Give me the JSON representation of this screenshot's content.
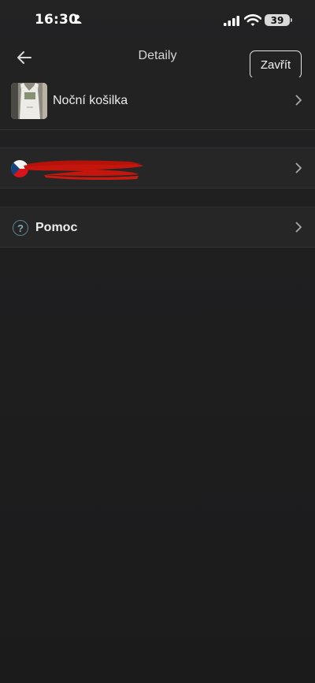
{
  "status_bar": {
    "time": "16:30",
    "battery": "39"
  },
  "header": {
    "title": "Detaily",
    "close_label": "Zavřít"
  },
  "rows": {
    "product": {
      "label": "Noční košilka"
    },
    "help": {
      "label": "Pomoc",
      "icon_glyph": "?"
    }
  },
  "colors": {
    "background": "#1f1f20",
    "row_background": "#262627",
    "redaction": "#c4160c",
    "help_icon": "#5d7f93"
  }
}
